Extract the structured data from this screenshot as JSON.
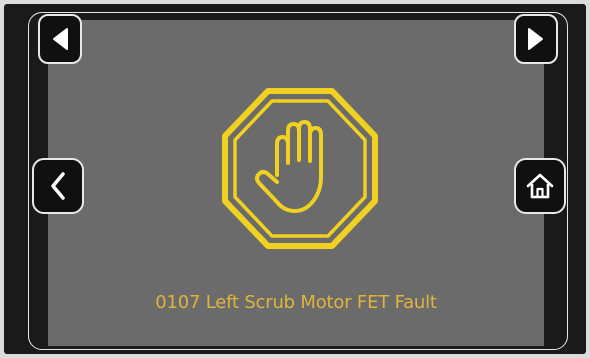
{
  "colors": {
    "screen_bg": "#6b6b6b",
    "bezel": "#1a1a1a",
    "accent_yellow": "#f0d020",
    "fault_text": "#e0b43c",
    "button_border": "#e8e8e8"
  },
  "nav": {
    "prev_icon": "triangle-left-icon",
    "next_icon": "triangle-right-icon",
    "back_icon": "chevron-left-icon",
    "home_icon": "home-icon"
  },
  "alert": {
    "icon": "stop-hand-icon",
    "message": "0107 Left Scrub Motor FET Fault"
  }
}
